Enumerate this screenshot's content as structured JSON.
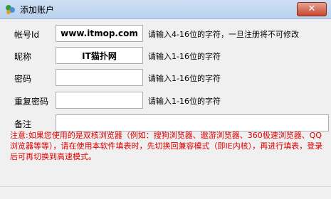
{
  "window": {
    "title": "添加账户",
    "close_label": "✕"
  },
  "form": {
    "account": {
      "label": "帐号Id",
      "value": "www.itmop.com",
      "hint": "请输入4-16位的字符，一旦注册将不可修改"
    },
    "nickname": {
      "label": "昵称",
      "value": "IT猫扑网",
      "hint": "请输入1-16位的字符"
    },
    "password": {
      "label": "密码",
      "value": "",
      "hint": "请输入1-16位的字符"
    },
    "confirm_password": {
      "label": "重复密码",
      "value": "",
      "hint": "请输入1-16位的字符"
    },
    "remark": {
      "label": "备注",
      "value": ""
    }
  },
  "notice": "注意:如果您使用的是双核浏览器（例如：搜狗浏览器、遨游浏览器、360极速浏览器、QQ浏览器等等），请在使用本软件填表时，先切换回兼容模式（即IE内核），再进行填表，登录后可再切换到高速模式。",
  "colors": {
    "notice": "#e00000",
    "titlebar": "#cfe0f5",
    "close_button": "#c7472e"
  }
}
